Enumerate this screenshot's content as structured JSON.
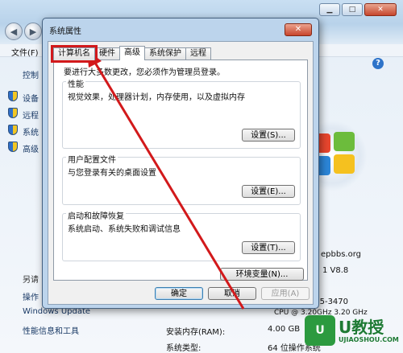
{
  "background": {
    "menu": {
      "file": "文件(F)"
    },
    "sidebar": {
      "home": "控制",
      "items": [
        "设备",
        "远程",
        "系统",
        "高级"
      ],
      "see_also": "另请",
      "links": [
        "操作",
        "Windows Update",
        "性能信息和工具"
      ]
    },
    "info": {
      "site": "epbbs.org",
      "version": "1 V8.8",
      "cpu_model": "TM) i5-3470",
      "cpu_speed": "CPU @ 3.20GHz   3.20 GHz",
      "ram_label": "安装内存(RAM):",
      "ram_value": "4.00 GB",
      "type_label": "系统类型:",
      "type_value": "64 位操作系统"
    },
    "watermark": {
      "logo": "U",
      "big": "U教授",
      "small": "UJIAOSHOU.COM"
    },
    "controls": {
      "minimize": "▁",
      "maximize": "□",
      "close": "✕",
      "back": "◀",
      "forward": "▶",
      "help": "?"
    }
  },
  "dialog": {
    "title": "系统属性",
    "close": "✕",
    "tabs": [
      "计算机名",
      "硬件",
      "高级",
      "系统保护",
      "远程"
    ],
    "admin_note": "要进行大多数更改，您必须作为管理员登录。",
    "groups": [
      {
        "title": "性能",
        "desc": "视觉效果，处理器计划，内存使用，以及虚拟内存",
        "button": "设置(S)..."
      },
      {
        "title": "用户配置文件",
        "desc": "与您登录有关的桌面设置",
        "button": "设置(E)..."
      },
      {
        "title": "启动和故障恢复",
        "desc": "系统启动、系统失败和调试信息",
        "button": "设置(T)..."
      }
    ],
    "env_button": "环境变量(N)...",
    "ok": "确定",
    "cancel": "取消",
    "apply": "应用(A)"
  },
  "annotation": {
    "highlight_color": "#d2191b",
    "arrow_color": "#d2191b"
  }
}
